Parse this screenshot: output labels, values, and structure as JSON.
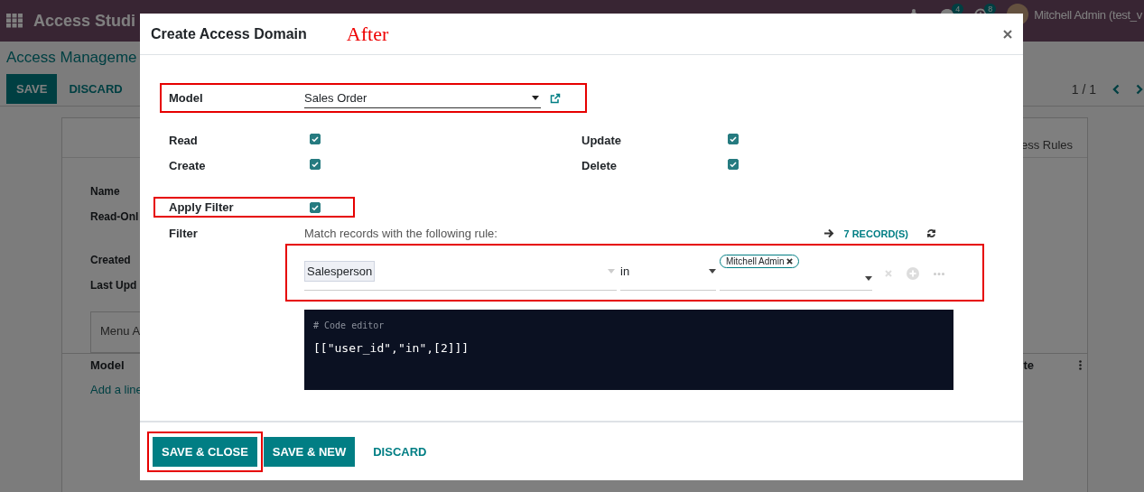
{
  "navbar": {
    "title": "Access Studi",
    "chat_badge": "4",
    "activity_badge": "8",
    "user": "Mitchell Admin (test_v"
  },
  "breadcrumb": "Access Manageme",
  "control_buttons": [
    {
      "label": "SAVE",
      "kind": "primary"
    },
    {
      "label": "DISCARD",
      "kind": "link"
    }
  ],
  "pager": "1 / 1",
  "form": {
    "smart_button": "ess Rules",
    "fields": [
      "Name",
      "Read-Onl",
      "Created",
      "Last Upd"
    ],
    "tabs": [
      {
        "label": "Menu A",
        "selected": true
      }
    ],
    "table": {
      "columns": [
        "Model",
        "te"
      ],
      "add_line": "Add a line"
    }
  },
  "dialog": {
    "title": "Create Access Domain",
    "annotation": "After",
    "model": {
      "label": "Model",
      "value": "Sales Order",
      "highlighted": true
    },
    "permissions": [
      {
        "label": "Read",
        "checked": true
      },
      {
        "label": "Update",
        "checked": true
      },
      {
        "label": "Create",
        "checked": true
      },
      {
        "label": "Delete",
        "checked": true
      }
    ],
    "apply_filter": {
      "label": "Apply Filter",
      "checked": true,
      "highlighted": true
    },
    "filter": {
      "label": "Filter",
      "description": "Match records with the following rule:",
      "records": "7 RECORD(S)",
      "rule": {
        "field": "Salesperson",
        "operator": "in",
        "values": [
          "Mitchell Admin"
        ],
        "highlighted": true
      },
      "code_editor": {
        "comment": "# Code editor",
        "code": "[[\"user_id\",\"in\",[2]]]"
      }
    },
    "buttons": [
      {
        "label": "SAVE & CLOSE",
        "kind": "primary",
        "highlighted": true
      },
      {
        "label": "SAVE & NEW",
        "kind": "primary",
        "highlighted": false
      },
      {
        "label": "DISCARD",
        "kind": "link",
        "highlighted": false
      }
    ]
  }
}
